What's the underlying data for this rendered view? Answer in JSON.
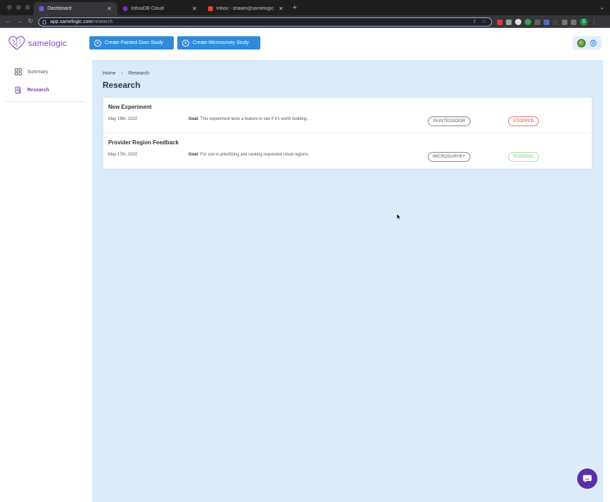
{
  "browser": {
    "tabs": [
      {
        "label": "Dashboard",
        "active": true,
        "favicon_color": "#6a5acd"
      },
      {
        "label": "InfluxDB Cloud",
        "active": false,
        "favicon_color": "#7b2fc4"
      },
      {
        "label": "Inbox - shawn@samelogic.com",
        "active": false,
        "favicon_color": "#ea4335"
      }
    ],
    "url": {
      "host": "app.samelogic.com",
      "path": "/research"
    },
    "profile_initial": "S"
  },
  "app": {
    "logo_text": "samelogic",
    "buttons": {
      "painted_door": "Create Painted Door Study",
      "microsurvey": "Create Microsurvey Study"
    },
    "sidebar": [
      {
        "label": "Summary",
        "icon": "grid-icon",
        "active": false
      },
      {
        "label": "Research",
        "icon": "research-icon",
        "active": true
      }
    ],
    "breadcrumb": [
      "Home",
      "Research"
    ],
    "page_title": "Research",
    "goal_label": "Goal:",
    "studies": [
      {
        "name": "New Experiment",
        "date": "May 19th, 2022",
        "goal": "This experiment tests a feature to see if it's worth building.",
        "type": "PAINTEDDOOR",
        "status": "STOPPED"
      },
      {
        "name": "Provider Region Feedback",
        "date": "May 17th, 2022",
        "goal": "For use in prioritizing and ranking requested cloud regions.",
        "type": "MICROSURVEY",
        "status": "RUNNING"
      }
    ]
  },
  "colors": {
    "accent": "#2e8bdc",
    "brand": "#7b4bbd",
    "content_bg": "#dcebf9",
    "stopped": "#e53935",
    "running": "#66d466"
  }
}
